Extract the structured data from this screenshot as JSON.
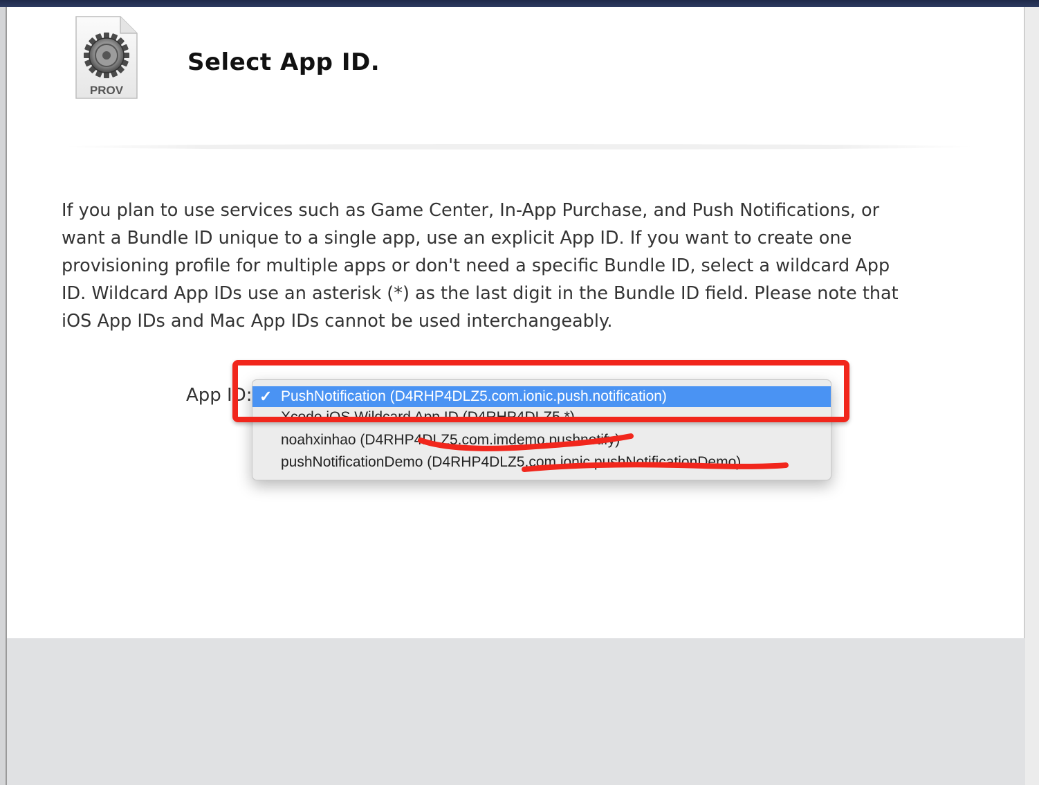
{
  "page": {
    "title": "Select App ID.",
    "icon_label": "PROV",
    "description": "If you plan to use services such as Game Center, In-App Purchase, and Push Notifications, or want a Bundle ID unique to a single app, use an explicit App ID. If you want to create one provisioning profile for multiple apps or don't need a specific Bundle ID, select a wildcard App ID. Wildcard App IDs use an asterisk (*) as the last digit in the Bundle ID field. Please note that iOS App IDs and Mac App IDs cannot be used interchangeably."
  },
  "form": {
    "app_id_label": "App ID:"
  },
  "dropdown": {
    "check_glyph": "✓",
    "options": [
      {
        "label": "PushNotification (D4RHP4DLZ5.com.ionic.push.notification)",
        "selected": true
      },
      {
        "label": "Xcode iOS Wildcard App ID (D4RHP4DLZ5.*)",
        "selected": false
      },
      {
        "label": "noahxinhao (D4RHP4DLZ5.com.imdemo.pushnotify)",
        "selected": false
      },
      {
        "label": "pushNotificationDemo (D4RHP4DLZ5.com.ionic.pushNotificationDemo)",
        "selected": false
      }
    ]
  },
  "annotations": {
    "highlight_color": "#f1261c"
  },
  "colors": {
    "selection": "#4a93f3",
    "top_bar": "#1f2a4a",
    "footer": "#e0e1e3"
  }
}
